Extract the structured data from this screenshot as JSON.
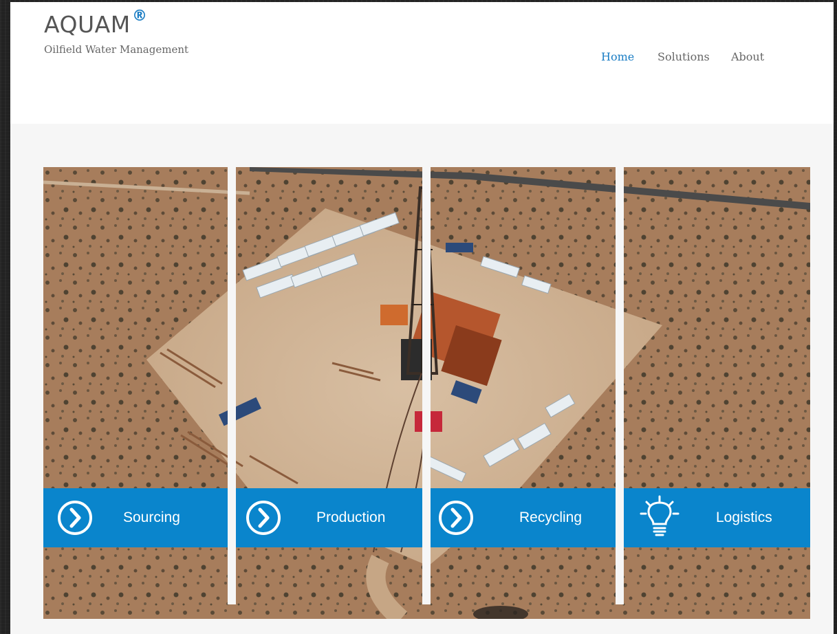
{
  "brand": {
    "name": "AQUAM",
    "registered_mark": "®",
    "tagline": "Oilfield Water Management",
    "accent_color": "#1a7dc4"
  },
  "nav": {
    "items": [
      {
        "label": "Home",
        "active": true
      },
      {
        "label": "Solutions",
        "active": false
      },
      {
        "label": "About",
        "active": false
      }
    ]
  },
  "hero": {
    "image_subject": "aerial view of an oilfield drilling site in desert",
    "panels": [
      {
        "label": "Sourcing",
        "icon": "chevron-right-circle-icon"
      },
      {
        "label": "Production",
        "icon": "chevron-right-circle-icon"
      },
      {
        "label": "Recycling",
        "icon": "chevron-right-circle-icon"
      },
      {
        "label": "Logistics",
        "icon": "lightbulb-icon"
      }
    ],
    "label_bar_color": "#0a85cc"
  }
}
